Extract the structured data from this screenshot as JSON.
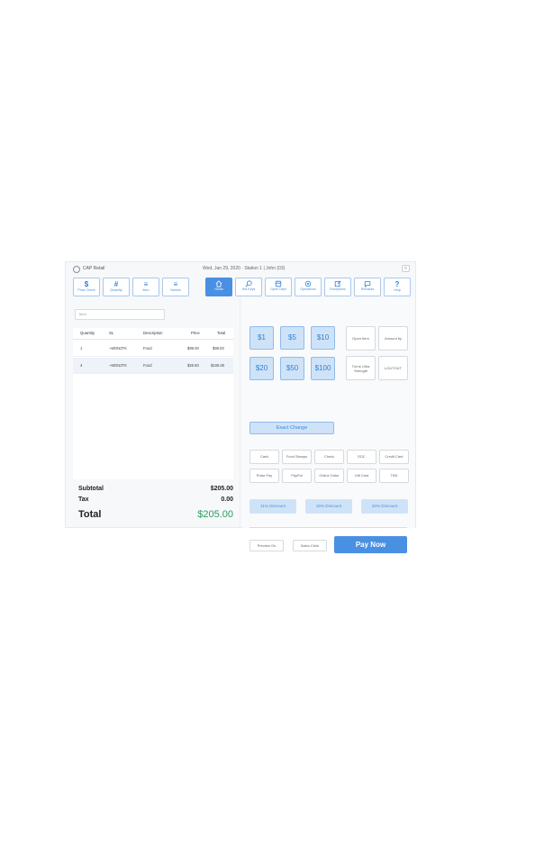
{
  "app": {
    "name": "CAP Retail",
    "status": "Wed, Jan 29, 2020  ·  Station 1  |  John (03)",
    "window_btn": "↻"
  },
  "toolbar": {
    "price_check": {
      "icon": "$",
      "label": "Price Check"
    },
    "quantity": {
      "icon": "#",
      "label": "Quantity"
    },
    "item": {
      "icon": "≡",
      "label": "Item"
    },
    "names": {
      "icon": "≡",
      "label": "Names"
    },
    "home": {
      "label": "Home"
    },
    "hot_keys": {
      "label": "Hot Keys"
    },
    "open_dept": {
      "label": "Open Dept"
    },
    "operations": {
      "label": "Operations"
    },
    "exceptions": {
      "label": "Exceptions"
    },
    "remarks": {
      "label": "Remarks"
    },
    "help": {
      "icon": "?",
      "label": "Help"
    }
  },
  "search": {
    "placeholder": "Item"
  },
  "table": {
    "headers": {
      "quantity": "Quantity",
      "sl": "SL",
      "description": "Description",
      "price": "Price",
      "total": "Total"
    },
    "rows": [
      {
        "quantity": "1",
        "sl": "~MON2TK",
        "description": "Food",
        "price": "$99.00",
        "total": "$99.00"
      },
      {
        "quantity": "4",
        "sl": "~MON2TK",
        "description": "Food",
        "price": "$26.50",
        "total": "$106.00"
      }
    ]
  },
  "totals": {
    "subtotal_label": "Subtotal",
    "subtotal": "$205.00",
    "tax_label": "Tax",
    "tax": "0.00",
    "total_label": "Total",
    "total": "$205.00",
    "total_color": "#2e9e5e"
  },
  "cash": {
    "b1": "$1",
    "b5": "$5",
    "b10": "$10",
    "b20": "$20",
    "b50": "$50",
    "b100": "$100"
  },
  "side_buttons": {
    "open_item": "Open Item",
    "amount_by": "Amount by",
    "turns_ultra": "Turns Ultra Strength",
    "loutout": "LOUTOUT"
  },
  "exact_change": "Exact Change",
  "tenders": {
    "cash": "Cash",
    "food_stamps": "Food Stamps",
    "check": "Check",
    "edc": "EDC",
    "credit_card": "Credit Card",
    "pulse_pay": "Pulse Pay",
    "paypal": "PayPal",
    "online_order": "Online Order",
    "gift_card": "Gift Card",
    "tbd": "TBD"
  },
  "discounts": {
    "d11": "11% Discount",
    "d15": "15% Discount",
    "d20": "20% Discount"
  },
  "footer": {
    "preview_on": "Preview On",
    "sales_clerk": "Sales Clerk",
    "pay_now": "Pay Now"
  },
  "colors": {
    "accent": "#4a90e2",
    "light_accent": "#cfe3f8",
    "total_green": "#2e9e5e"
  }
}
